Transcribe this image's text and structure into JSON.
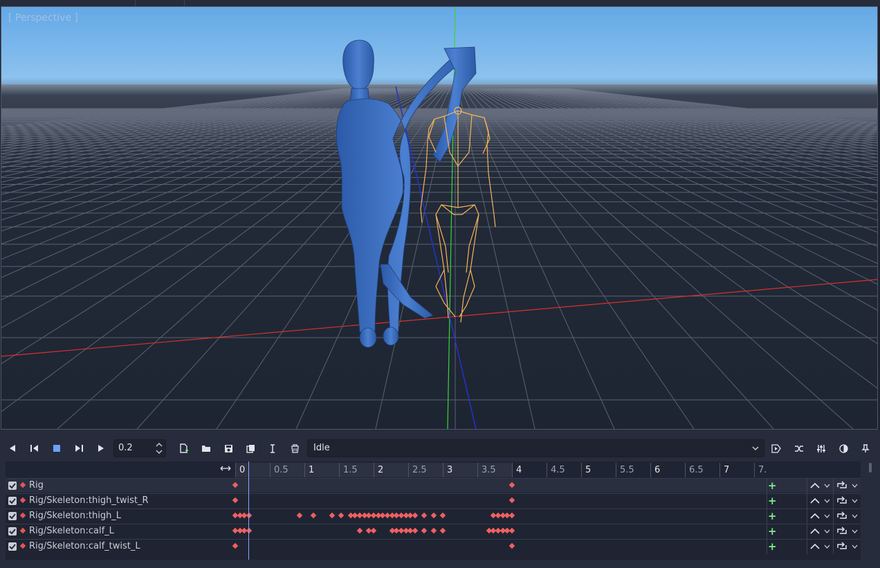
{
  "viewport": {
    "label": "[ Perspective ]"
  },
  "toolbar": {
    "step_value": "0.2",
    "animation_selected": "Idle",
    "buttons": [
      "play-backwards-icon",
      "step-back-icon",
      "stop-icon",
      "step-forward-icon",
      "play-icon",
      "new-animation-icon",
      "open-icon",
      "save-icon",
      "duplicate-icon",
      "rename-icon",
      "delete-icon",
      "autoplay-icon",
      "blend-icon",
      "edit-icon",
      "onion-skin-icon",
      "pin-icon"
    ]
  },
  "timeline": {
    "ruler_ticks": [
      {
        "label": "0",
        "t": 0
      },
      {
        "label": "0.5",
        "t": 0.5
      },
      {
        "label": "1",
        "t": 1
      },
      {
        "label": "1.5",
        "t": 1.5
      },
      {
        "label": "2",
        "t": 2
      },
      {
        "label": "2.5",
        "t": 2.5
      },
      {
        "label": "3",
        "t": 3
      },
      {
        "label": "3.5",
        "t": 3.5
      },
      {
        "label": "4",
        "t": 4
      },
      {
        "label": "4.5",
        "t": 4.5
      },
      {
        "label": "5",
        "t": 5
      },
      {
        "label": "5.5",
        "t": 5.5
      },
      {
        "label": "6",
        "t": 6
      },
      {
        "label": "6.5",
        "t": 6.5
      },
      {
        "label": "7",
        "t": 7
      },
      {
        "label": "7.",
        "t": 7.5
      }
    ],
    "animation_length": 4,
    "cursor_time": 0.2,
    "tracks": [
      {
        "name": "Rig",
        "keys": [
          0,
          4
        ]
      },
      {
        "name": "Rig/Skeleton:thigh_twist_R",
        "keys": [
          0,
          4
        ]
      },
      {
        "name": "Rig/Skeleton:thigh_L",
        "keys": [
          0,
          0.07,
          0.13,
          0.2,
          0.93,
          1.13,
          1.4,
          1.53,
          1.67,
          1.73,
          1.8,
          1.87,
          1.93,
          2.0,
          2.07,
          2.13,
          2.2,
          2.27,
          2.33,
          2.4,
          2.47,
          2.53,
          2.6,
          2.73,
          2.87,
          3.0,
          3.73,
          3.8,
          3.87,
          3.93,
          4.0
        ]
      },
      {
        "name": "Rig/Skeleton:calf_L",
        "keys": [
          0,
          0.07,
          0.13,
          0.2,
          1.8,
          1.93,
          2.0,
          2.27,
          2.33,
          2.4,
          2.47,
          2.53,
          2.6,
          2.73,
          2.87,
          3.0,
          3.67,
          3.73,
          3.8,
          3.87,
          3.93,
          4.0
        ]
      },
      {
        "name": "Rig/Skeleton:calf_twist_L",
        "keys": [
          0,
          4
        ]
      }
    ]
  }
}
